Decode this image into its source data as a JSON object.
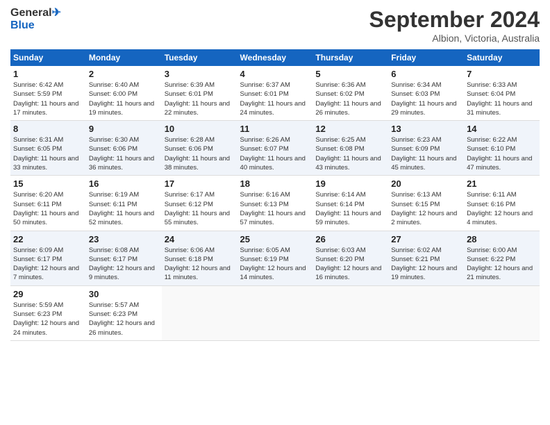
{
  "header": {
    "logo_line1": "General",
    "logo_line2": "Blue",
    "month_title": "September 2024",
    "subtitle": "Albion, Victoria, Australia"
  },
  "weekdays": [
    "Sunday",
    "Monday",
    "Tuesday",
    "Wednesday",
    "Thursday",
    "Friday",
    "Saturday"
  ],
  "weeks": [
    [
      {
        "day": "1",
        "sunrise": "6:42 AM",
        "sunset": "5:59 PM",
        "daylight": "Daylight: 11 hours and 17 minutes."
      },
      {
        "day": "2",
        "sunrise": "6:40 AM",
        "sunset": "6:00 PM",
        "daylight": "Daylight: 11 hours and 19 minutes."
      },
      {
        "day": "3",
        "sunrise": "6:39 AM",
        "sunset": "6:01 PM",
        "daylight": "Daylight: 11 hours and 22 minutes."
      },
      {
        "day": "4",
        "sunrise": "6:37 AM",
        "sunset": "6:01 PM",
        "daylight": "Daylight: 11 hours and 24 minutes."
      },
      {
        "day": "5",
        "sunrise": "6:36 AM",
        "sunset": "6:02 PM",
        "daylight": "Daylight: 11 hours and 26 minutes."
      },
      {
        "day": "6",
        "sunrise": "6:34 AM",
        "sunset": "6:03 PM",
        "daylight": "Daylight: 11 hours and 29 minutes."
      },
      {
        "day": "7",
        "sunrise": "6:33 AM",
        "sunset": "6:04 PM",
        "daylight": "Daylight: 11 hours and 31 minutes."
      }
    ],
    [
      {
        "day": "8",
        "sunrise": "6:31 AM",
        "sunset": "6:05 PM",
        "daylight": "Daylight: 11 hours and 33 minutes."
      },
      {
        "day": "9",
        "sunrise": "6:30 AM",
        "sunset": "6:06 PM",
        "daylight": "Daylight: 11 hours and 36 minutes."
      },
      {
        "day": "10",
        "sunrise": "6:28 AM",
        "sunset": "6:06 PM",
        "daylight": "Daylight: 11 hours and 38 minutes."
      },
      {
        "day": "11",
        "sunrise": "6:26 AM",
        "sunset": "6:07 PM",
        "daylight": "Daylight: 11 hours and 40 minutes."
      },
      {
        "day": "12",
        "sunrise": "6:25 AM",
        "sunset": "6:08 PM",
        "daylight": "Daylight: 11 hours and 43 minutes."
      },
      {
        "day": "13",
        "sunrise": "6:23 AM",
        "sunset": "6:09 PM",
        "daylight": "Daylight: 11 hours and 45 minutes."
      },
      {
        "day": "14",
        "sunrise": "6:22 AM",
        "sunset": "6:10 PM",
        "daylight": "Daylight: 11 hours and 47 minutes."
      }
    ],
    [
      {
        "day": "15",
        "sunrise": "6:20 AM",
        "sunset": "6:11 PM",
        "daylight": "Daylight: 11 hours and 50 minutes."
      },
      {
        "day": "16",
        "sunrise": "6:19 AM",
        "sunset": "6:11 PM",
        "daylight": "Daylight: 11 hours and 52 minutes."
      },
      {
        "day": "17",
        "sunrise": "6:17 AM",
        "sunset": "6:12 PM",
        "daylight": "Daylight: 11 hours and 55 minutes."
      },
      {
        "day": "18",
        "sunrise": "6:16 AM",
        "sunset": "6:13 PM",
        "daylight": "Daylight: 11 hours and 57 minutes."
      },
      {
        "day": "19",
        "sunrise": "6:14 AM",
        "sunset": "6:14 PM",
        "daylight": "Daylight: 11 hours and 59 minutes."
      },
      {
        "day": "20",
        "sunrise": "6:13 AM",
        "sunset": "6:15 PM",
        "daylight": "Daylight: 12 hours and 2 minutes."
      },
      {
        "day": "21",
        "sunrise": "6:11 AM",
        "sunset": "6:16 PM",
        "daylight": "Daylight: 12 hours and 4 minutes."
      }
    ],
    [
      {
        "day": "22",
        "sunrise": "6:09 AM",
        "sunset": "6:17 PM",
        "daylight": "Daylight: 12 hours and 7 minutes."
      },
      {
        "day": "23",
        "sunrise": "6:08 AM",
        "sunset": "6:17 PM",
        "daylight": "Daylight: 12 hours and 9 minutes."
      },
      {
        "day": "24",
        "sunrise": "6:06 AM",
        "sunset": "6:18 PM",
        "daylight": "Daylight: 12 hours and 11 minutes."
      },
      {
        "day": "25",
        "sunrise": "6:05 AM",
        "sunset": "6:19 PM",
        "daylight": "Daylight: 12 hours and 14 minutes."
      },
      {
        "day": "26",
        "sunrise": "6:03 AM",
        "sunset": "6:20 PM",
        "daylight": "Daylight: 12 hours and 16 minutes."
      },
      {
        "day": "27",
        "sunrise": "6:02 AM",
        "sunset": "6:21 PM",
        "daylight": "Daylight: 12 hours and 19 minutes."
      },
      {
        "day": "28",
        "sunrise": "6:00 AM",
        "sunset": "6:22 PM",
        "daylight": "Daylight: 12 hours and 21 minutes."
      }
    ],
    [
      {
        "day": "29",
        "sunrise": "5:59 AM",
        "sunset": "6:23 PM",
        "daylight": "Daylight: 12 hours and 24 minutes."
      },
      {
        "day": "30",
        "sunrise": "5:57 AM",
        "sunset": "6:23 PM",
        "daylight": "Daylight: 12 hours and 26 minutes."
      },
      null,
      null,
      null,
      null,
      null
    ]
  ]
}
